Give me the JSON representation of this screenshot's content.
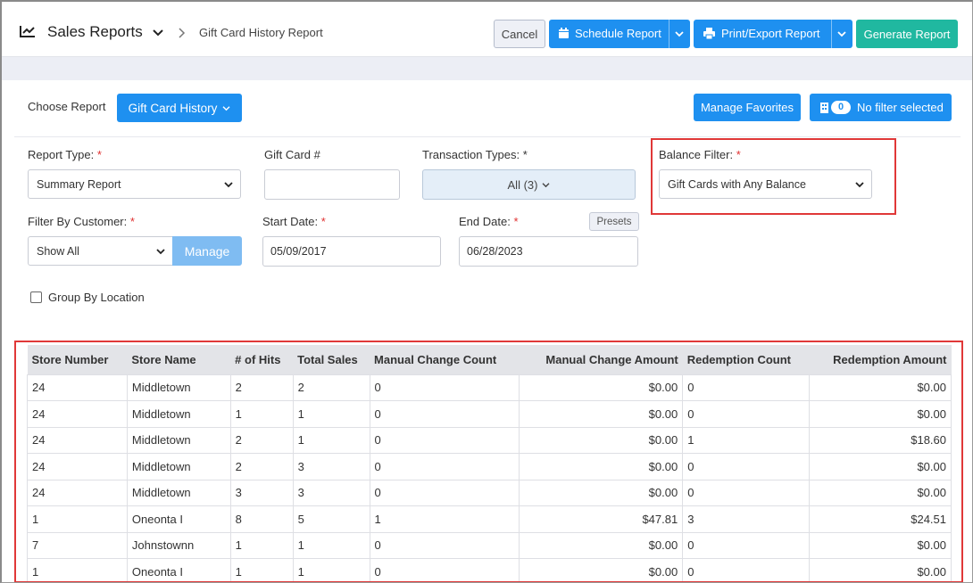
{
  "header": {
    "title": "Sales Reports",
    "breadcrumb": "Gift Card History Report",
    "cancel_label": "Cancel",
    "schedule_label": "Schedule Report",
    "print_label": "Print/Export Report",
    "generate_label": "Generate Report"
  },
  "report_bar": {
    "choose_label": "Choose Report",
    "report_select": "Gift Card History",
    "favorites_label": "Manage Favorites",
    "filter_count": "0",
    "filter_label": "No filter selected"
  },
  "form": {
    "report_type_label": "Report Type:",
    "report_type_value": "Summary Report",
    "gift_card_label": "Gift Card #",
    "gift_card_value": "",
    "transaction_types_label": "Transaction Types: *",
    "transaction_types_value": "All (3)",
    "balance_filter_label": "Balance Filter:",
    "balance_filter_value": "Gift Cards with Any Balance",
    "customer_label": "Filter By Customer:",
    "customer_value": "Show All",
    "manage_label": "Manage",
    "start_date_label": "Start Date:",
    "start_date_value": "05/09/2017",
    "end_date_label": "End Date:",
    "end_date_value": "06/28/2023",
    "presets_label": "Presets",
    "group_by_label": "Group By Location",
    "required_mark": "*"
  },
  "table": {
    "columns": [
      "Store Number",
      "Store Name",
      "# of Hits",
      "Total Sales",
      "Manual Change Count",
      "Manual Change Amount",
      "Redemption Count",
      "Redemption Amount"
    ],
    "rows": [
      [
        "24",
        "Middletown",
        "2",
        "2",
        "0",
        "$0.00",
        "0",
        "$0.00"
      ],
      [
        "24",
        "Middletown",
        "1",
        "1",
        "0",
        "$0.00",
        "0",
        "$0.00"
      ],
      [
        "24",
        "Middletown",
        "2",
        "1",
        "0",
        "$0.00",
        "1",
        "$18.60"
      ],
      [
        "24",
        "Middletown",
        "2",
        "3",
        "0",
        "$0.00",
        "0",
        "$0.00"
      ],
      [
        "24",
        "Middletown",
        "3",
        "3",
        "0",
        "$0.00",
        "0",
        "$0.00"
      ],
      [
        "1",
        "Oneonta I",
        "8",
        "5",
        "1",
        "$47.81",
        "3",
        "$24.51"
      ],
      [
        "7",
        "Johnstownn",
        "1",
        "1",
        "0",
        "$0.00",
        "0",
        "$0.00"
      ],
      [
        "1",
        "Oneonta I",
        "1",
        "1",
        "0",
        "$0.00",
        "0",
        "$0.00"
      ]
    ]
  },
  "colors": {
    "primary": "#1e90f0",
    "generate": "#20b8a0",
    "highlight": "#e03838",
    "required": "#e03030"
  }
}
